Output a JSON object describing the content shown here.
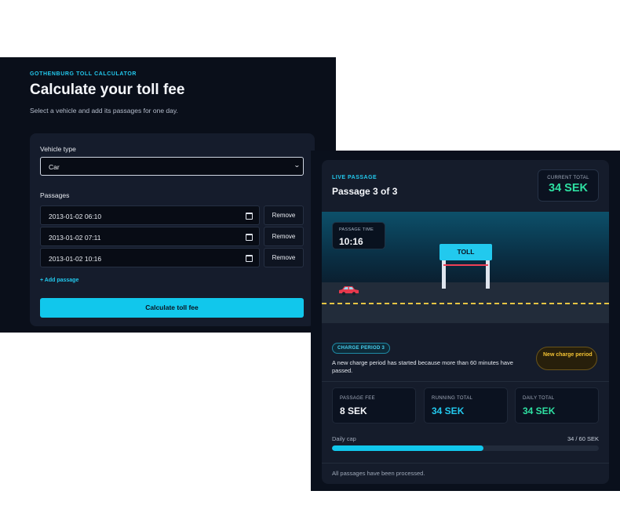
{
  "calculator": {
    "eyebrow": "GOTHENBURG TOLL CALCULATOR",
    "title": "Calculate your toll fee",
    "subtitle": "Select a vehicle and add its passages for one day.",
    "vehicle_label": "Vehicle type",
    "vehicle_value": "Car",
    "passages_label": "Passages",
    "passages": [
      {
        "value": "2013-01-02 06:10",
        "remove_label": "Remove"
      },
      {
        "value": "2013-01-02 07:11",
        "remove_label": "Remove"
      },
      {
        "value": "2013-01-02 10:16",
        "remove_label": "Remove"
      }
    ],
    "add_passage_label": "+ Add passage",
    "calculate_label": "Calculate toll fee"
  },
  "live": {
    "eyebrow": "LIVE PASSAGE",
    "title": "Passage 3 of 3",
    "current_total_label": "CURRENT TOTAL",
    "current_total_value": "34 SEK",
    "passage_time_label": "PASSAGE TIME",
    "passage_time_value": "10:16",
    "toll_sign": "TOLL",
    "charge_period_chip": "CHARGE PERIOD 3",
    "charge_description": "A new charge period has started because more than 60 minutes have passed.",
    "new_charge_badge": "New charge period",
    "stats": [
      {
        "label": "PASSAGE FEE",
        "value": "8 SEK",
        "color": "#f5f7fb"
      },
      {
        "label": "RUNNING TOTAL",
        "value": "34 SEK",
        "color": "#22c9ee"
      },
      {
        "label": "DAILY TOTAL",
        "value": "34 SEK",
        "color": "#2ee0a2"
      }
    ],
    "daily_cap_label": "Daily cap",
    "daily_cap_value": "34 / 60 SEK",
    "daily_cap_fraction": 0.567,
    "footer": "All passages have been processed."
  },
  "colors": {
    "accent": "#22c9ee",
    "total_green": "#2ee0a2",
    "warning": "#f2c233",
    "toll_bar": "#ef4056",
    "lane_marking": "#e6c544",
    "car": "#e8394d"
  },
  "icons": [
    "calendar-icon",
    "chevron-down-icon",
    "car-icon",
    "toll-gate-icon"
  ]
}
